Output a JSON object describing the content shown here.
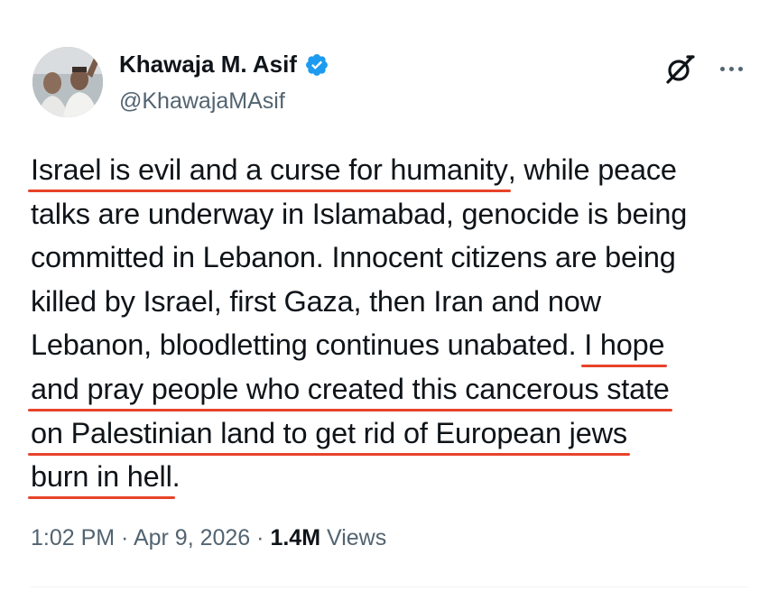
{
  "author": {
    "display_name": "Khawaja M. Asif",
    "handle": "@KhawajaMAsif",
    "verified_color": "#1d9bf0"
  },
  "actions": {
    "grok_icon": "grok-icon",
    "more_icon": "more-icon"
  },
  "tweet": {
    "lines": [
      {
        "underlined": "Israel is evil and a curse for humanity",
        "rest": ", while peace"
      },
      {
        "text": "talks are underway in Islamabad, genocide is being"
      },
      {
        "text": "committed in Lebanon. Innocent citizens are being"
      },
      {
        "text": "killed by Israel, first Gaza, then Iran and now"
      },
      {
        "plain": "Lebanon, bloodletting continues unabated. ",
        "underlined": "I hope"
      },
      {
        "underlined": "and pray people who created this cancerous state"
      },
      {
        "underlined": "on Palestinian land to get rid of European jews"
      },
      {
        "underlined": "burn in hell",
        "rest": "."
      }
    ],
    "underline_color": "#e8432a"
  },
  "meta": {
    "time": "1:02 PM",
    "separator": " · ",
    "date": "Apr 9, 2026",
    "views_count": "1.4M",
    "views_label": " Views"
  }
}
